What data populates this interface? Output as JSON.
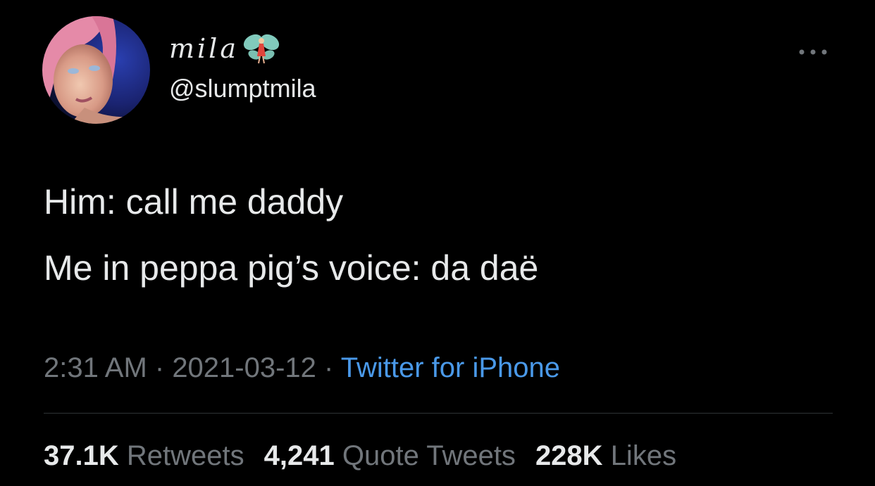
{
  "user": {
    "display_name": "mila",
    "handle": "@slumptmila",
    "display_name_emoji": "fairy-icon"
  },
  "tweet": {
    "lines": [
      "Him: call me daddy",
      "Me in peppa pig’s voice: da daë"
    ]
  },
  "meta": {
    "time": "2:31 AM",
    "separator": " · ",
    "date": "2021-03-12",
    "source": "Twitter for iPhone"
  },
  "stats": {
    "retweets_count": "37.1K",
    "retweets_label": "Retweets",
    "quotes_count": "4,241",
    "quotes_label": "Quote Tweets",
    "likes_count": "228K",
    "likes_label": "Likes"
  },
  "colors": {
    "background": "#000000",
    "text": "#e7e9ea",
    "secondary": "#71767b",
    "link": "#4a99e9",
    "divider": "#2f3336"
  }
}
